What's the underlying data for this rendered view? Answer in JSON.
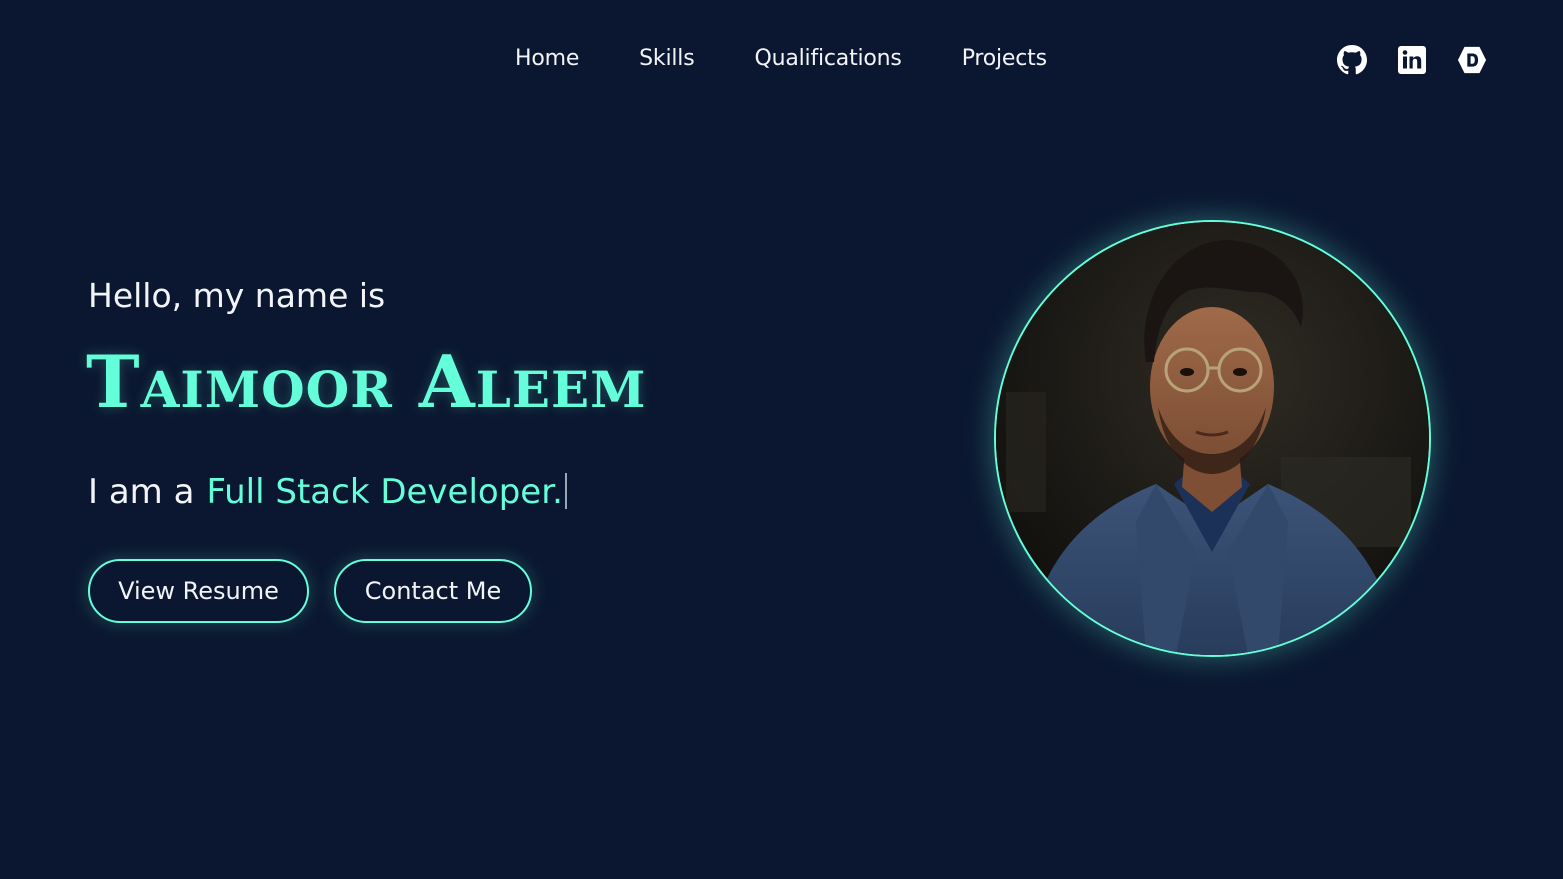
{
  "nav": {
    "links": [
      {
        "label": "Home"
      },
      {
        "label": "Skills"
      },
      {
        "label": "Qualifications"
      },
      {
        "label": "Projects"
      }
    ],
    "socials": [
      {
        "icon": "github-icon"
      },
      {
        "icon": "linkedin-icon"
      },
      {
        "icon": "dev-icon"
      }
    ]
  },
  "hero": {
    "greeting": "Hello, my name is",
    "name": "Taimoor Aleem",
    "role_prefix": "I am a",
    "role_typed": "Full Stack Developer.",
    "buttons": {
      "resume": "View Resume",
      "contact": "Contact Me"
    }
  },
  "colors": {
    "background": "#0b1730",
    "accent": "#64ffda",
    "text": "#f2f4f8"
  }
}
